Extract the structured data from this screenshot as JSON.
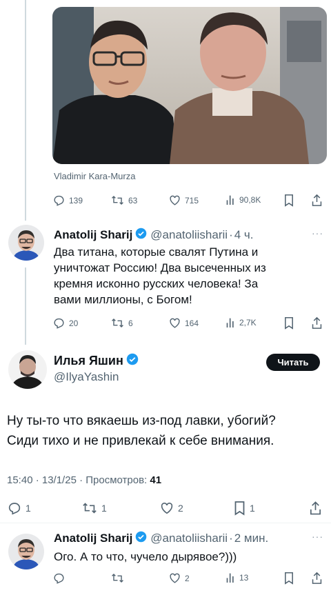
{
  "quoted_tweet": {
    "caption": "Vladimir Kara-Murza",
    "stats": {
      "replies": "139",
      "reposts": "63",
      "likes": "715",
      "views": "90,8K"
    }
  },
  "reply_tweet": {
    "name": "Anatolij Sharij",
    "handle": "@anatoliisharii",
    "separator": "·",
    "time": "4 ч.",
    "text_lines": [
      "Два титана, которые свалят Путина и",
      "уничтожат Россию! Два высеченных из",
      "кремня исконно русских человека! За",
      "вами миллионы, с Богом!"
    ],
    "stats": {
      "replies": "20",
      "reposts": "6",
      "likes": "164",
      "views": "2,7K"
    }
  },
  "main_tweet": {
    "name": "Илья Яшин",
    "handle": "@IlyaYashin",
    "follow_label": "Читать",
    "text_lines": [
      "Ну ты-то что вякаешь из-под лавки, убогий?",
      "Сиди тихо и не привлекай к себе внимания."
    ],
    "meta": "15:40 · 13/1/25 · Просмотров: ",
    "views": "41",
    "stats": {
      "replies": "1",
      "reposts": "1",
      "likes": "2",
      "bookmarks": "1"
    }
  },
  "last_reply": {
    "name": "Anatolij Sharij",
    "handle": "@anatoliisharii",
    "separator": "·",
    "time": "2 мин.",
    "text": "Ого. А то что, чучело дырявое?)))",
    "stats": {
      "likes": "2",
      "views": "13"
    }
  },
  "colors": {
    "text": "#0f1419",
    "secondary": "#536471",
    "verified": "#1d9bf0",
    "line": "#cfd9de"
  },
  "icons": [
    "reply-icon",
    "repost-icon",
    "like-icon",
    "views-icon",
    "bookmark-icon",
    "share-icon",
    "verified-icon",
    "more-icon"
  ]
}
